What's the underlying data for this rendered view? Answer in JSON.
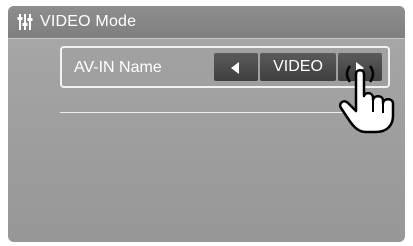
{
  "header": {
    "title": "VIDEO Mode",
    "icon": "settings-sliders-icon"
  },
  "setting": {
    "label": "AV-IN Name",
    "value": "VIDEO",
    "prev_icon": "triangle-left-icon",
    "next_icon": "triangle-right-icon"
  },
  "overlay": {
    "icon": "pointing-hand-icon"
  },
  "colors": {
    "background": "#a5a5a5",
    "titlebar": "#878787",
    "button": "#4a4a4a",
    "text": "#ffffff"
  }
}
